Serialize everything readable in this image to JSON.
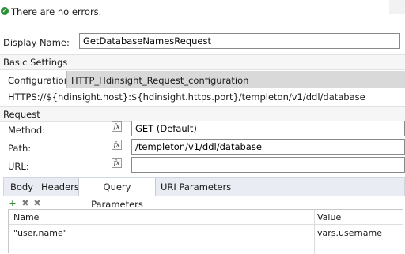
{
  "status": {
    "message": "There are no errors.",
    "icon": "check-circle-icon"
  },
  "display_name": {
    "label": "Display Name:",
    "value": "GetDatabaseNamesRequest"
  },
  "basic_settings": {
    "title": "Basic Settings",
    "configuration_label": "Configuration:",
    "configuration_value": "HTTP_Hdinsight_Request_configuration",
    "url_template": "HTTPS://${hdinsight.host}:${hdinsight.https.port}/templeton/v1/ddl/database"
  },
  "request": {
    "title": "Request",
    "fields": [
      {
        "label": "Method:",
        "fx": "fx",
        "value": "GET (Default)"
      },
      {
        "label": "Path:",
        "fx": "fx",
        "value": "/templeton/v1/ddl/database"
      },
      {
        "label": "URL:",
        "fx": "fx",
        "value": ""
      }
    ]
  },
  "tabs": [
    {
      "label": "Body",
      "active": false
    },
    {
      "label": "Headers",
      "active": false
    },
    {
      "label": "Query Parameters",
      "active": true
    },
    {
      "label": "URI Parameters",
      "active": false
    }
  ],
  "toolbar": {
    "add_icon": "plus-icon",
    "remove_icon": "x-icon",
    "remove_all_icon": "clear-icon"
  },
  "table": {
    "columns": [
      "Name",
      "Value"
    ],
    "rows": [
      {
        "name": "\"user.name\"",
        "value": "vars.username"
      }
    ]
  },
  "colors": {
    "ok": "#2f8f3a",
    "config_bg": "#d9d9d9",
    "tabs_bg": "#e9edf3"
  }
}
